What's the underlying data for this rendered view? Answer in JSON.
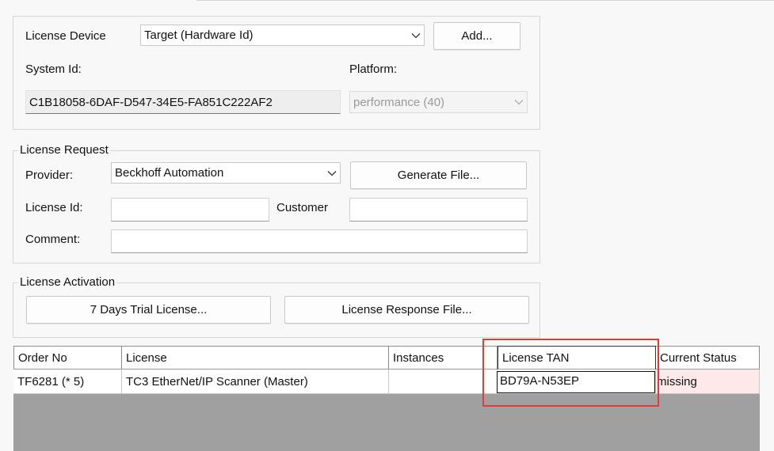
{
  "license_device": {
    "label": "License Device",
    "target_value": "Target (Hardware Id)",
    "add_button": "Add...",
    "system_id_label": "System Id:",
    "system_id_value": "C1B18058-6DAF-D547-34E5-FA851C222AF2",
    "platform_label": "Platform:",
    "platform_value": "performance (40)"
  },
  "license_request": {
    "title": "License Request",
    "provider_label": "Provider:",
    "provider_value": "Beckhoff Automation",
    "generate_button": "Generate File...",
    "license_id_label": "License Id:",
    "license_id_value": "",
    "customer_label": "Customer",
    "customer_value": "",
    "comment_label": "Comment:",
    "comment_value": ""
  },
  "license_activation": {
    "title": "License Activation",
    "trial_button": "7 Days Trial License...",
    "response_button": "License Response File..."
  },
  "grid": {
    "columns": [
      "Order No",
      "License",
      "Instances",
      "License TAN",
      "Current Status"
    ],
    "rows": [
      {
        "order_no": "TF6281 (* 5)",
        "license": "TC3 EtherNet/IP Scanner (Master)",
        "instances": "",
        "license_tan": "BD79A-N53EP",
        "status": "missing"
      }
    ]
  },
  "colors": {
    "highlight": "#e03c3c",
    "status_missing_bg": "#fde8ea",
    "grid_empty_area": "#a0a0a0"
  },
  "icons": {
    "combo_arrow": "chevron-down-icon"
  }
}
